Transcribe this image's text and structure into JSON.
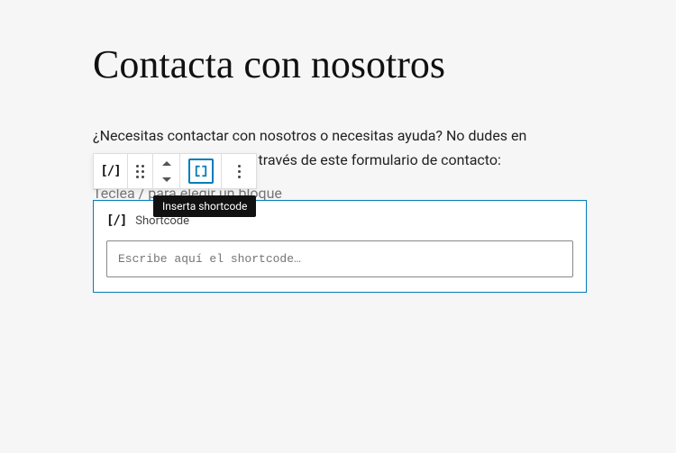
{
  "page": {
    "title": "Contacta con nosotros",
    "intro": "¿Necesitas contactar con nosotros o necesitas ayuda? No dudes en llamarnos o escribirnos a través de este formulario de contacto:",
    "slash_placeholder": "Teclea / para elegir un bloque"
  },
  "toolbar": {
    "type_icon_name": "shortcode",
    "tooltip": "Inserta shortcode"
  },
  "block": {
    "label": "Shortcode",
    "input_placeholder": "Escribe aquí el shortcode…",
    "input_value": ""
  }
}
